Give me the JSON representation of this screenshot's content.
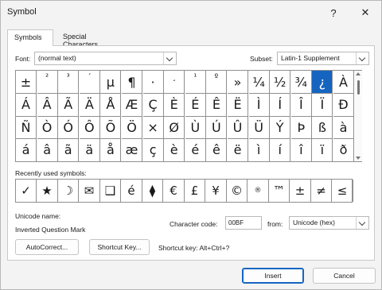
{
  "window": {
    "title": "Symbol",
    "help_label": "?",
    "close_label": "✕"
  },
  "tabs": [
    {
      "label": "Symbols",
      "active": true
    },
    {
      "label": "Special Characters",
      "active": false
    }
  ],
  "font": {
    "label": "Font:",
    "value": "(normal text)"
  },
  "subset": {
    "label": "Subset:",
    "value": "Latin-1 Supplement"
  },
  "symbol_grid": {
    "rows": [
      [
        "±",
        "²",
        "³",
        "´",
        "µ",
        "¶",
        "·",
        "¸",
        "¹",
        "º",
        "»",
        "¼",
        "½",
        "¾",
        "¿",
        "À"
      ],
      [
        "Á",
        "Â",
        "Ã",
        "Ä",
        "Å",
        "Æ",
        "Ç",
        "È",
        "É",
        "Ê",
        "Ë",
        "Ì",
        "Í",
        "Î",
        "Ï",
        "Ð"
      ],
      [
        "Ñ",
        "Ò",
        "Ó",
        "Ô",
        "Õ",
        "Ö",
        "×",
        "Ø",
        "Ù",
        "Ú",
        "Û",
        "Ü",
        "Ý",
        "Þ",
        "ß",
        "à"
      ],
      [
        "á",
        "â",
        "ã",
        "ä",
        "å",
        "æ",
        "ç",
        "è",
        "é",
        "ê",
        "ë",
        "ì",
        "í",
        "î",
        "ï",
        "ð"
      ]
    ],
    "selected_symbol": "¿"
  },
  "recent": {
    "label": "Recently used symbols:",
    "symbols": [
      "✓",
      "★",
      "☽",
      "✉",
      "❑",
      "é",
      "⧫",
      "€",
      "£",
      "¥",
      "©",
      "®",
      "™",
      "±",
      "≠",
      "≤"
    ]
  },
  "unicode": {
    "name_label": "Unicode name:",
    "name_value": "Inverted Question Mark"
  },
  "char_code": {
    "label": "Character code:",
    "value": "00BF"
  },
  "from": {
    "label": "from:",
    "value": "Unicode (hex)"
  },
  "buttons": {
    "autocorrect": "AutoCorrect...",
    "shortcut_key": "Shortcut Key...",
    "insert": "Insert",
    "cancel": "Cancel"
  },
  "shortcut": {
    "text": "Shortcut key: Alt+Ctrl+?"
  },
  "colors": {
    "selection": "#1565c0",
    "grid_border": "#8f8f8f"
  }
}
